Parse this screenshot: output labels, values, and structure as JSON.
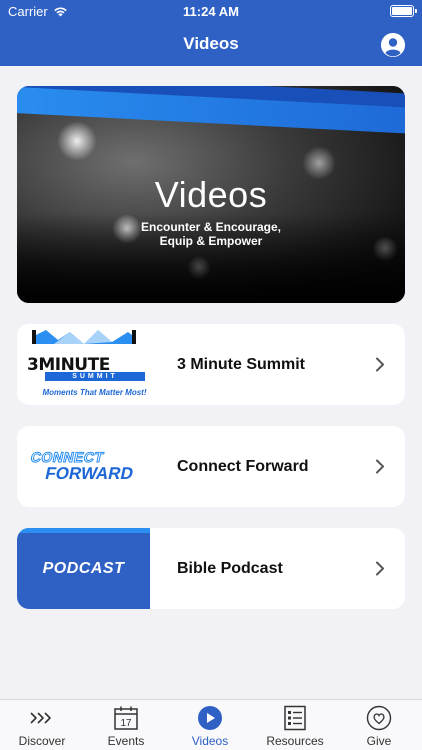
{
  "status_bar": {
    "carrier": "Carrier",
    "time": "11:24 AM"
  },
  "header": {
    "title": "Videos",
    "profile_icon": "person-circle-icon"
  },
  "banner": {
    "title": "Videos",
    "subtitle_line1": "Encounter & Encourage,",
    "subtitle_line2": "Equip & Empower"
  },
  "cards": [
    {
      "label": "3 Minute Summit",
      "thumb_line1": "3MINUTE",
      "thumb_line2": "SUMMIT",
      "thumb_tagline": "Moments That Matter Most!"
    },
    {
      "label": "Connect Forward",
      "thumb_line1": "CONNECT",
      "thumb_line2": "FORWARD"
    },
    {
      "label": "Bible Podcast",
      "thumb_text": "PODCAST"
    }
  ],
  "tabs": [
    {
      "label": "Discover",
      "icon": "chevrons-right-icon",
      "active": false
    },
    {
      "label": "Events",
      "icon": "calendar-icon",
      "calendar_day": "17",
      "active": false
    },
    {
      "label": "Videos",
      "icon": "play-circle-icon",
      "active": true
    },
    {
      "label": "Resources",
      "icon": "list-document-icon",
      "active": false
    },
    {
      "label": "Give",
      "icon": "heart-circle-icon",
      "active": false
    }
  ],
  "colors": {
    "primary": "#2f61c5",
    "accent_light": "#2a8ff0",
    "background": "#f1f1f6"
  }
}
